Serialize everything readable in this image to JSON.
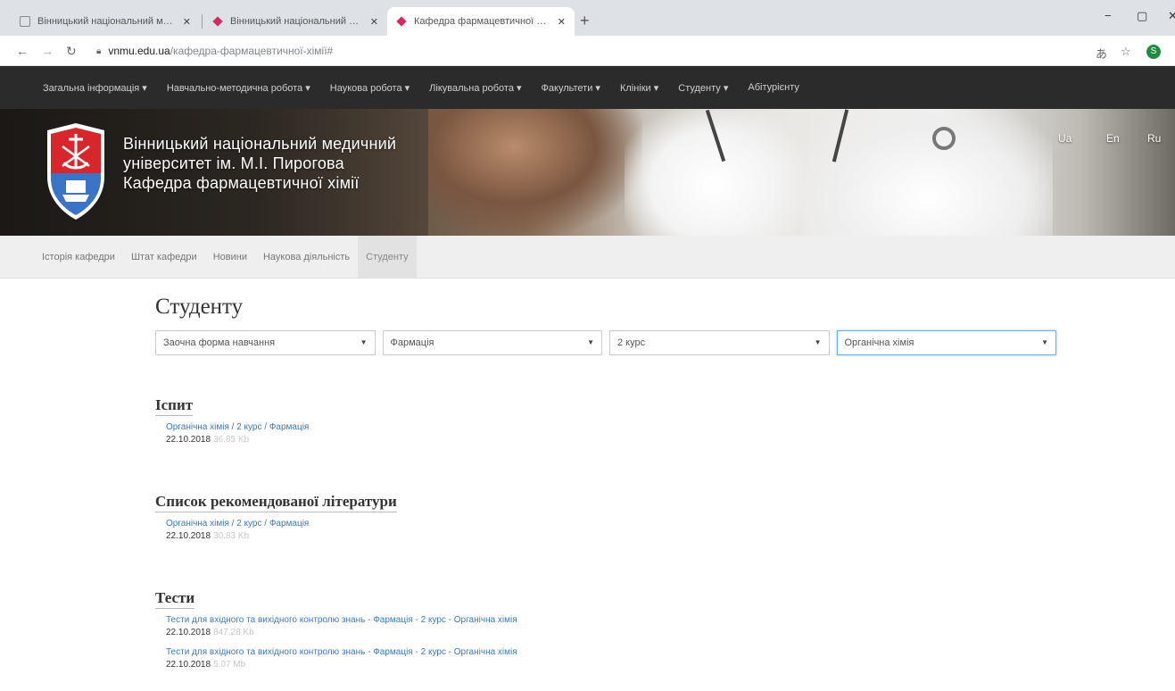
{
  "browser": {
    "tabs": [
      {
        "title": "Вінницький національний медичний університет",
        "active": false
      },
      {
        "title": "Вінницький національний медичний університет",
        "active": false
      },
      {
        "title": "Кафедра фармацевтичної хімії",
        "active": true
      }
    ],
    "url_host": "vnmu.edu.ua",
    "url_path": "/кафедра-фармацевтичної-хімії#",
    "profile_initial": "S"
  },
  "topnav": [
    "Загальна інформація ▾",
    "Навчально-методична робота ▾",
    "Наукова робота ▾",
    "Лікувальна робота ▾",
    "Факультети ▾",
    "Клініки ▾",
    "Студенту ▾",
    "Абітурієнту"
  ],
  "banner": {
    "line1": "Вінницький національний медичний",
    "line2": "університет ім. М.І. Пирогова",
    "line3": "Кафедра фармацевтичної хімії",
    "lang_ua": "Ua",
    "lang_en": "En",
    "lang_ru": "Ru"
  },
  "subnav": [
    "Історія кафедри",
    "Штат кафедри",
    "Новини",
    "Наукова діяльність",
    "Студенту"
  ],
  "page_title": "Студенту",
  "filters": [
    "Заочна форма навчання",
    "Фармація",
    "2 курс",
    "Органічна хімія"
  ],
  "sections": [
    {
      "title": "Іспит",
      "docs": [
        {
          "link": "Органічна хімія / 2 курс / Фармація",
          "date": "22.10.2018",
          "size": "36.85 Kb"
        }
      ]
    },
    {
      "title": "Список рекомендованої літератури",
      "docs": [
        {
          "link": "Органічна хімія / 2 курс / Фармація",
          "date": "22.10.2018",
          "size": "30.83 Kb"
        }
      ]
    },
    {
      "title": "Тести",
      "docs": [
        {
          "link": "Тести для вхідного та вихідного контролю знань - Фармація - 2 курс - Органічна хімія",
          "date": "22.10.2018",
          "size": "847.28 Kb"
        },
        {
          "link": "Тести для вхідного та вихідного контролю знань - Фармація - 2 курс - Органічна хімія",
          "date": "22.10.2018",
          "size": "5.07 Mb"
        }
      ]
    }
  ]
}
